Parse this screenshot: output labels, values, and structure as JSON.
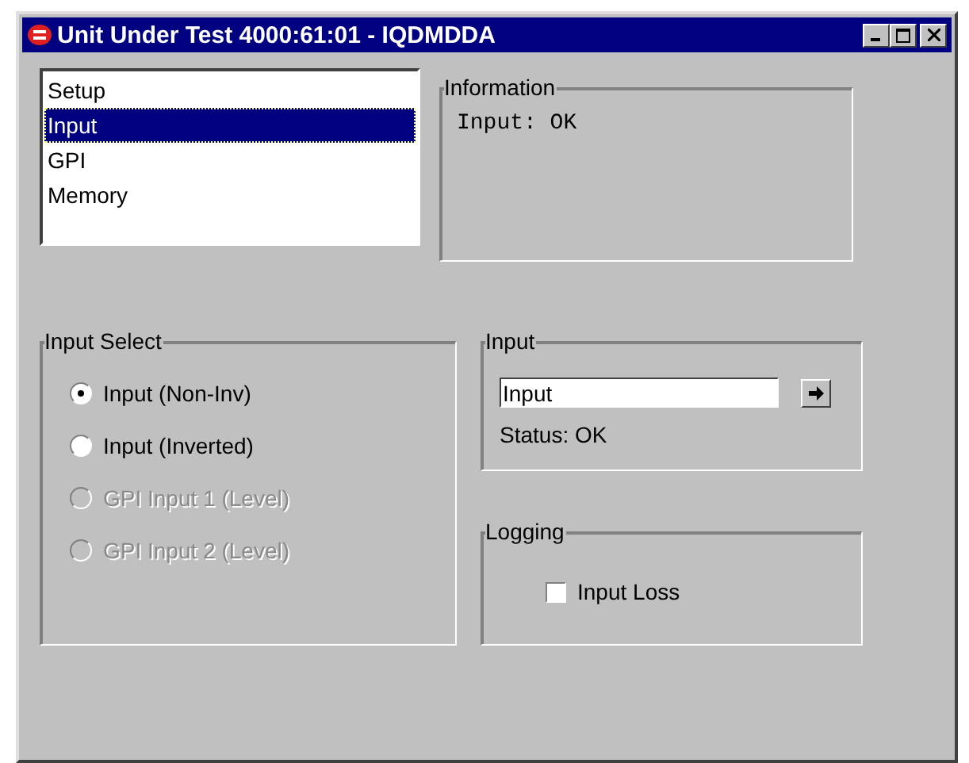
{
  "window": {
    "title": "Unit Under Test 4000:61:01 - IQDMDDA"
  },
  "nav_list": {
    "items": [
      {
        "label": "Setup",
        "selected": false
      },
      {
        "label": "Input",
        "selected": true
      },
      {
        "label": "GPI",
        "selected": false
      },
      {
        "label": "Memory",
        "selected": false
      }
    ]
  },
  "information": {
    "title": "Information",
    "text": "Input: OK"
  },
  "input_select": {
    "title": "Input Select",
    "options": [
      {
        "label": "Input (Non-Inv)",
        "selected": true,
        "disabled": false
      },
      {
        "label": "Input (Inverted)",
        "selected": false,
        "disabled": false
      },
      {
        "label": "GPI Input 1 (Level)",
        "selected": false,
        "disabled": true
      },
      {
        "label": "GPI Input 2 (Level)",
        "selected": false,
        "disabled": true
      }
    ]
  },
  "input": {
    "title": "Input",
    "value": "Input",
    "status": "Status: OK"
  },
  "logging": {
    "title": "Logging",
    "checkbox": {
      "label": "Input Loss",
      "checked": false
    }
  }
}
